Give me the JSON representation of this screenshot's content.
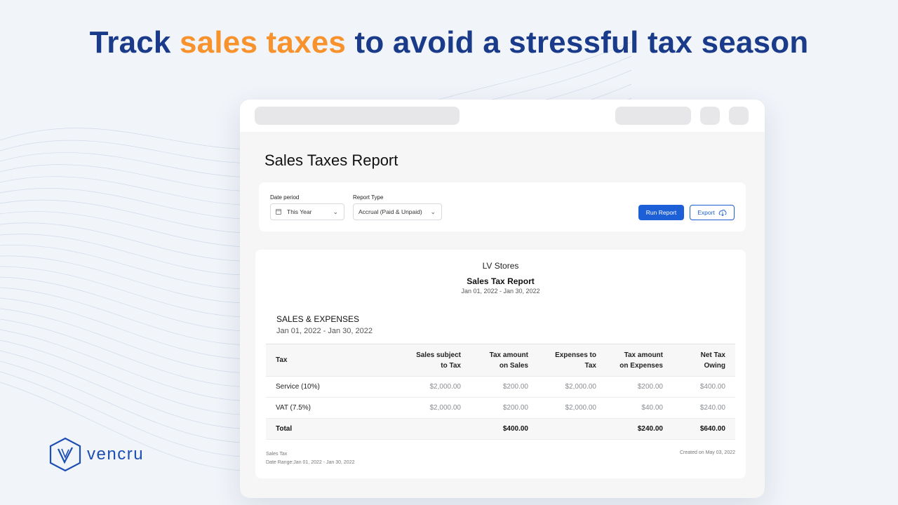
{
  "headline": {
    "part1": "Track ",
    "accent": "sales taxes",
    "part2": " to avoid a stressful tax season"
  },
  "brand": {
    "name": "vencru",
    "primary_color": "#1d4fb3",
    "accent_color": "#f7922d"
  },
  "page": {
    "title": "Sales Taxes Report"
  },
  "filters": {
    "date_period_label": "Date period",
    "date_period_value": "This Year",
    "report_type_label": "Report Type",
    "report_type_value": "Accrual (Paid & Unpaid)",
    "run_label": "Run Report",
    "export_label": "Export"
  },
  "report": {
    "company": "LV Stores",
    "title": "Sales Tax Report",
    "range": "Jan 01, 2022 - Jan 30, 2022",
    "section_title": "SALES & EXPENSES",
    "section_range": "Jan 01, 2022 - Jan 30, 2022",
    "columns": {
      "tax": "Tax",
      "sales_1": "Sales subject",
      "sales_2": "to Tax",
      "taxsales_1": "Tax amount",
      "taxsales_2": "on Sales",
      "exp_1": "Expenses to",
      "exp_2": "Tax",
      "taxexp_1": "Tax amount",
      "taxexp_2": "on Expenses",
      "net": "Net Tax Owing"
    },
    "rows": [
      {
        "tax": "Service (10%)",
        "sales": "$2,000.00",
        "tax_sales": "$200.00",
        "expenses": "$2,000.00",
        "tax_expenses": "$200.00",
        "net": "$400.00"
      },
      {
        "tax": "VAT (7.5%)",
        "sales": "$2,000.00",
        "tax_sales": "$200.00",
        "expenses": "$2,000.00",
        "tax_expenses": "$40.00",
        "net": "$240.00"
      }
    ],
    "total": {
      "label": "Total",
      "sales": "",
      "tax_sales": "$400.00",
      "expenses": "",
      "tax_expenses": "$240.00",
      "net": "$640.00"
    },
    "footer": {
      "left_line1": "Sales Tax",
      "left_line2": "Date Range:Jan 01, 2022 - Jan 30, 2022",
      "right": "Created on May 03, 2022"
    }
  }
}
